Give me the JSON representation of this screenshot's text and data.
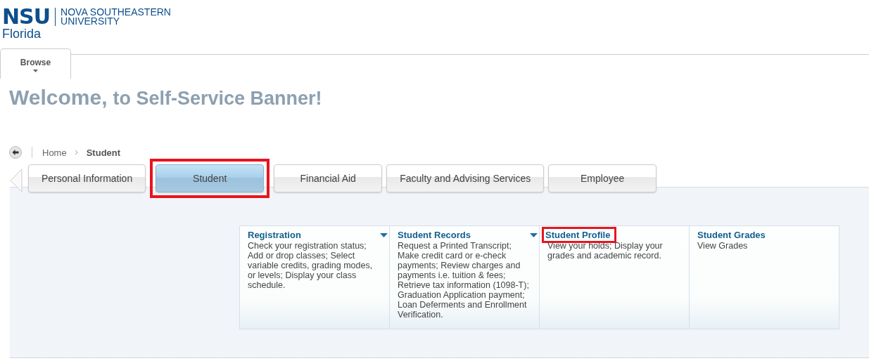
{
  "logo": {
    "mark": "NSU",
    "name_line_1": "NOVA SOUTHEASTERN",
    "name_line_2": "UNIVERSITY",
    "place": "Florida"
  },
  "browse": {
    "label": "Browse"
  },
  "welcome": {
    "part_1": "Welcome,",
    "part_2": "to Self-Service Banner!"
  },
  "breadcrumb": [
    "Home",
    "Student"
  ],
  "tabs": [
    {
      "label": "Personal Information",
      "selected": false,
      "highlighted": false
    },
    {
      "label": "Student",
      "selected": true,
      "highlighted": true
    },
    {
      "label": "Financial Aid",
      "selected": false,
      "highlighted": false
    },
    {
      "label": "Faculty and Advising Services",
      "selected": false,
      "highlighted": false
    },
    {
      "label": "Employee",
      "selected": false,
      "highlighted": false
    }
  ],
  "cards": [
    {
      "title": "Registration",
      "text": "Check your registration status; Add or drop classes; Select variable credits, grading modes, or levels; Display your class schedule.",
      "has_menu": true,
      "highlighted": false
    },
    {
      "title": "Student Records",
      "text": "Request a Printed Transcript; Make credit card or e-check payments; Review charges and payments i.e. tuition & fees; Retrieve tax information (1098-T); Graduation Application payment; Loan Deferments and Enrollment Verification.",
      "has_menu": true,
      "highlighted": false
    },
    {
      "title": "Student Profile",
      "text": "View your holds; Display your grades and academic record.",
      "has_menu": false,
      "highlighted": true
    },
    {
      "title": "Student Grades",
      "text": "View Grades",
      "has_menu": false,
      "highlighted": false
    }
  ]
}
